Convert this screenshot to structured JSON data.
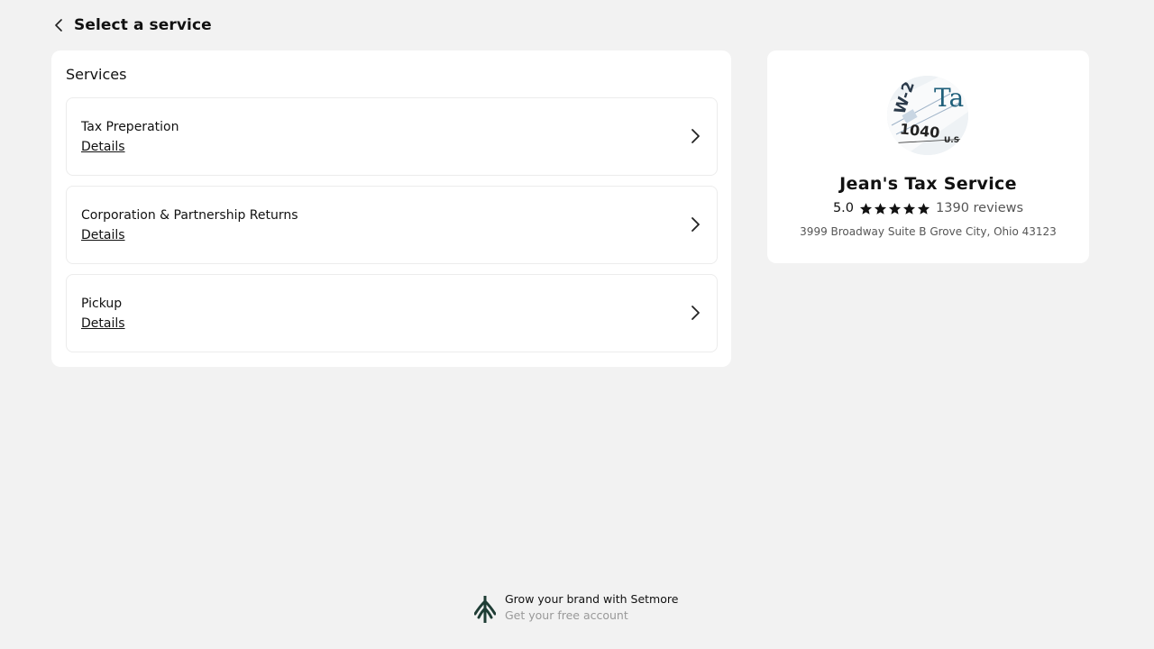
{
  "header": {
    "title": "Select a service"
  },
  "services": {
    "title": "Services",
    "items": [
      {
        "name": "Tax Preperation",
        "details_label": "Details"
      },
      {
        "name": "Corporation & Partnership Returns",
        "details_label": "Details"
      },
      {
        "name": "Pickup",
        "details_label": "Details"
      }
    ]
  },
  "business": {
    "name": "Jean's Tax Service",
    "rating": "5.0",
    "stars": 5,
    "reviews": "1390 reviews",
    "address": "3999 Broadway Suite B Grove City, Ohio 43123",
    "avatar_text": {
      "form_a": "W-2",
      "form_b": "1040",
      "tax": "Ta",
      "us": "U.S"
    }
  },
  "footer": {
    "line1": "Grow your brand with Setmore",
    "line2": "Get your free account"
  },
  "colors": {
    "background": "#f2f2f2",
    "card": "#ffffff",
    "logo": "#1f3d35",
    "star": "#111111"
  }
}
